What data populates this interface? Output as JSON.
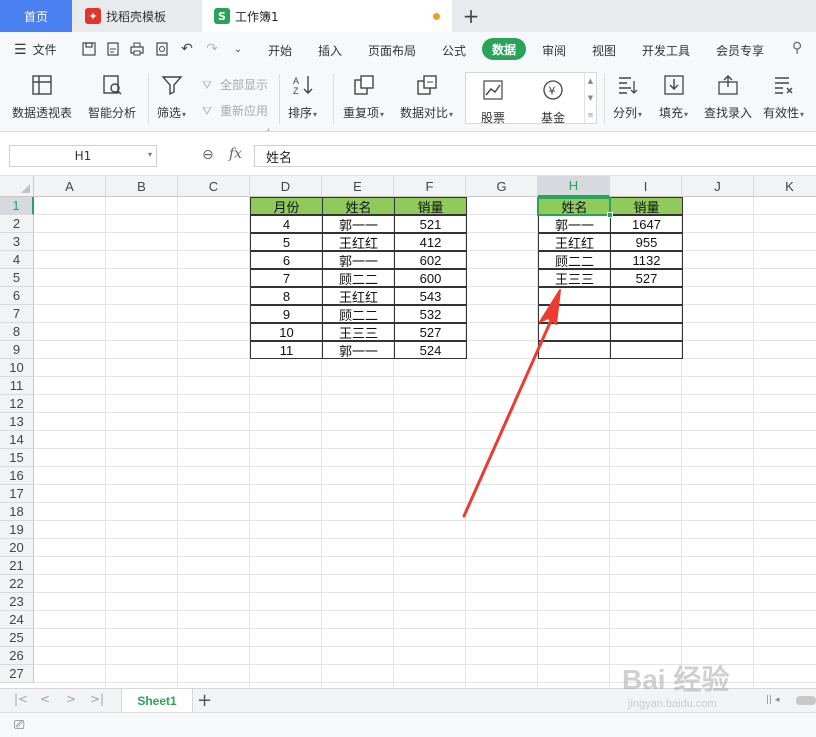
{
  "tabs": {
    "home": "首页",
    "templates": "找稻壳模板",
    "workbook": "工作簿1",
    "new_tab": "+"
  },
  "menu": {
    "file": "文件",
    "items": [
      "开始",
      "插入",
      "页面布局",
      "公式",
      "数据",
      "审阅",
      "视图",
      "开发工具",
      "会员专享"
    ],
    "active": "数据"
  },
  "ribbon": {
    "pivot": "数据透视表",
    "smart_analysis": "智能分析",
    "filter": "筛选",
    "show_all": "全部显示",
    "reapply": "重新应用",
    "sort": "排序",
    "duplicates": "重复项",
    "compare": "数据对比",
    "stock": "股票",
    "fund": "基金",
    "split": "分列",
    "fill": "填充",
    "lookup": "查找录入",
    "validity": "有效性"
  },
  "formula_bar": {
    "name_box": "H1",
    "fx": "fx",
    "content": "姓名"
  },
  "columns": [
    "A",
    "B",
    "C",
    "D",
    "E",
    "F",
    "G",
    "H",
    "I",
    "J",
    "K"
  ],
  "rows": [
    "1",
    "2",
    "3",
    "4",
    "5",
    "6",
    "7",
    "8",
    "9",
    "10",
    "11",
    "12",
    "13",
    "14",
    "15",
    "16",
    "17",
    "18",
    "19",
    "20",
    "21",
    "22",
    "23",
    "24",
    "25",
    "26",
    "27"
  ],
  "selected_cell": {
    "col": "H",
    "row": "1"
  },
  "table_left": {
    "headers": [
      "月份",
      "姓名",
      "销量"
    ],
    "rows": [
      [
        "4",
        "郭一一",
        "521"
      ],
      [
        "5",
        "王红红",
        "412"
      ],
      [
        "6",
        "郭一一",
        "602"
      ],
      [
        "7",
        "顾二二",
        "600"
      ],
      [
        "8",
        "王红红",
        "543"
      ],
      [
        "9",
        "顾二二",
        "532"
      ],
      [
        "10",
        "王三三",
        "527"
      ],
      [
        "11",
        "郭一一",
        "524"
      ]
    ]
  },
  "table_right": {
    "headers": [
      "姓名",
      "销量"
    ],
    "rows": [
      [
        "郭一一",
        "1647"
      ],
      [
        "王红红",
        "955"
      ],
      [
        "顾二二",
        "1132"
      ],
      [
        "王三三",
        "527"
      ],
      [
        "",
        ""
      ],
      [
        "",
        ""
      ],
      [
        "",
        ""
      ],
      [
        "",
        ""
      ]
    ]
  },
  "sheet_tabs": {
    "active": "Sheet1",
    "add": "+"
  },
  "watermark": {
    "main": "Bai 经验",
    "sub": "jingyan.baidu.com"
  },
  "colors": {
    "accent_green": "#27a35a",
    "header_fill": "#8fca5b",
    "home_tab": "#4a7ff0",
    "arrow": "#ee3b30"
  }
}
